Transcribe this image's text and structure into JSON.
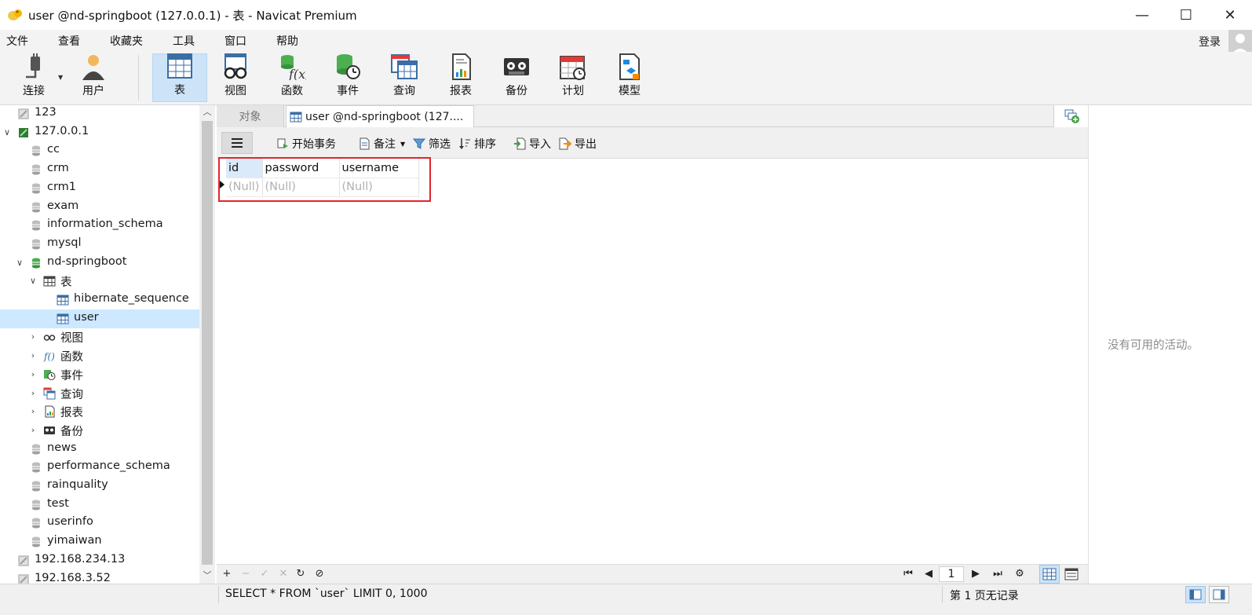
{
  "window": {
    "title": "user @nd-springboot (127.0.0.1) - 表 - Navicat Premium",
    "minimize": "—",
    "maximize": "☐",
    "close": "✕"
  },
  "menu": {
    "items": [
      "文件",
      "查看",
      "收藏夹",
      "工具",
      "窗口",
      "帮助"
    ],
    "login": "登录"
  },
  "toolbar": {
    "connect": "连接",
    "user": "用户",
    "table": "表",
    "view": "视图",
    "function": "函数",
    "event": "事件",
    "query": "查询",
    "report": "报表",
    "backup": "备份",
    "schedule": "计划",
    "model": "模型"
  },
  "tree": {
    "items": [
      {
        "label": "123",
        "icon": "server-off-icon"
      },
      {
        "label": "127.0.0.1",
        "icon": "server-on-icon"
      },
      {
        "label": "cc",
        "icon": "database-icon"
      },
      {
        "label": "crm",
        "icon": "database-icon"
      },
      {
        "label": "crm1",
        "icon": "database-icon"
      },
      {
        "label": "exam",
        "icon": "database-icon"
      },
      {
        "label": "information_schema",
        "icon": "database-icon"
      },
      {
        "label": "mysql",
        "icon": "database-icon"
      },
      {
        "label": "nd-springboot",
        "icon": "database-open-icon"
      },
      {
        "label": "表",
        "icon": "table-folder-icon"
      },
      {
        "label": "hibernate_sequence",
        "icon": "table-icon"
      },
      {
        "label": "user",
        "icon": "table-icon"
      },
      {
        "label": "视图",
        "icon": "view-icon"
      },
      {
        "label": "函数",
        "icon": "function-icon"
      },
      {
        "label": "事件",
        "icon": "event-icon"
      },
      {
        "label": "查询",
        "icon": "query-icon"
      },
      {
        "label": "报表",
        "icon": "report-icon"
      },
      {
        "label": "备份",
        "icon": "backup-icon"
      },
      {
        "label": "news",
        "icon": "database-icon"
      },
      {
        "label": "performance_schema",
        "icon": "database-icon"
      },
      {
        "label": "rainquality",
        "icon": "database-icon"
      },
      {
        "label": "test",
        "icon": "database-icon"
      },
      {
        "label": "userinfo",
        "icon": "database-icon"
      },
      {
        "label": "yimaiwan",
        "icon": "database-icon"
      },
      {
        "label": "192.168.234.13",
        "icon": "server-off-icon"
      },
      {
        "label": "192.168.3.52",
        "icon": "server-off-icon"
      }
    ]
  },
  "tabs": {
    "objects": "对象",
    "active": "user @nd-springboot (127...."
  },
  "subtoolbar": {
    "begin_transaction": "开始事务",
    "memo": "备注",
    "filter": "筛选",
    "sort": "排序",
    "import": "导入",
    "export": "导出"
  },
  "grid": {
    "columns": [
      "id",
      "password",
      "username"
    ],
    "rows": [
      [
        "(Null)",
        "(Null)",
        "(Null)"
      ]
    ]
  },
  "right_panel": {
    "message": "没有可用的活动。"
  },
  "navbar": {
    "add": "+",
    "remove": "−",
    "apply": "✓",
    "discard": "✕",
    "refresh": "↻",
    "stop": "⊘",
    "first": "⏮",
    "prev": "◀",
    "page": "1",
    "next": "▶",
    "last": "⏭",
    "settings": "⚙"
  },
  "status": {
    "sql": "SELECT * FROM `user` LIMIT 0, 1000",
    "records": "第 1 页无记录"
  },
  "colors": {
    "accent_selected": "#cde3f7",
    "highlight_box": "#e0262b",
    "db_green": "#4caf50"
  }
}
